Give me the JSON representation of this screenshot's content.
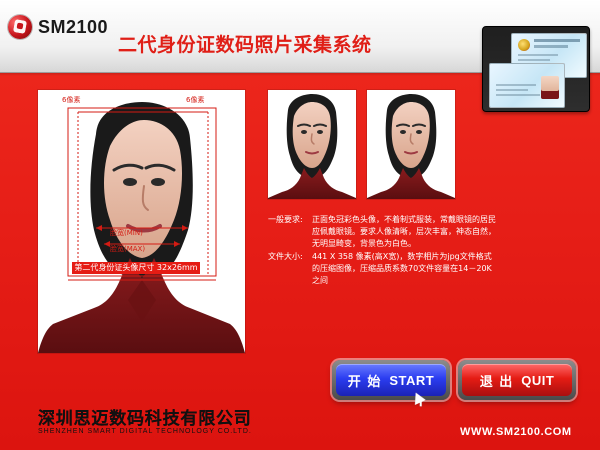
{
  "header": {
    "logo_text": "SM2100",
    "title": "二代身份证数码照片采集系统"
  },
  "guide_photo": {
    "annotation_top_left": "6像素",
    "annotation_top_right": "6像素",
    "annotation_mid_min": "脸宽(MIN)",
    "annotation_mid_max": "脸宽(MAX)",
    "caption": "第二代身份证头像尺寸 32x26mm"
  },
  "requirements": {
    "general_label": "一般要求:",
    "general_text": "正面免冠彩色头像，不着制式服装，常戴眼镜的居民应佩戴眼镜。要求人像清晰，层次丰富，神态自然，无明显畸变，背景色为白色。",
    "filesize_label": "文件大小:",
    "filesize_text": "441 X 358 像素(高X宽)，数字相片为jpg文件格式的压缩图像，压缩品质系数70文件容量在14－20K之间"
  },
  "buttons": {
    "start_cn": "开 始",
    "start_en": "START",
    "quit_cn": "退 出",
    "quit_en": "QUIT"
  },
  "footer": {
    "company_cn": "深圳思迈数码科技有限公司",
    "company_en": "SHENZHEN SMART DIGITAL TECHNOLOGY CO.LTD.",
    "website": "WWW.SM2100.COM"
  },
  "colors": {
    "brand_red": "#e01f17",
    "start_blue": "#2b3df0",
    "quit_red": "#e51c14"
  }
}
